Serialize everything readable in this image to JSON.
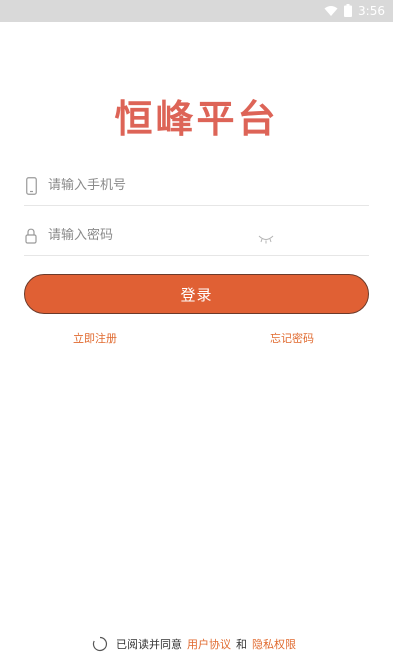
{
  "status_bar": {
    "time": "3:56",
    "wifi_icon": "wifi-icon",
    "battery_icon": "battery-icon"
  },
  "app": {
    "logo_text": "恒峰平台",
    "logo_color": "#dd6457"
  },
  "login_form": {
    "phone_placeholder": "请输入手机号",
    "phone_value": "",
    "phone_icon": "phone-icon",
    "password_placeholder": "请输入密码",
    "password_value": "",
    "password_icon": "lock-icon",
    "password_toggle_icon": "eye-closed-icon",
    "login_label": "登录",
    "accent_color": "#e06034"
  },
  "links": {
    "register": "立即注册",
    "forgot_password": "忘记密码"
  },
  "agreement": {
    "prefix": "已阅读并同意",
    "user_agreement": "用户协议",
    "conjunction": "和",
    "privacy_policy": "隐私权限",
    "checked": false
  }
}
